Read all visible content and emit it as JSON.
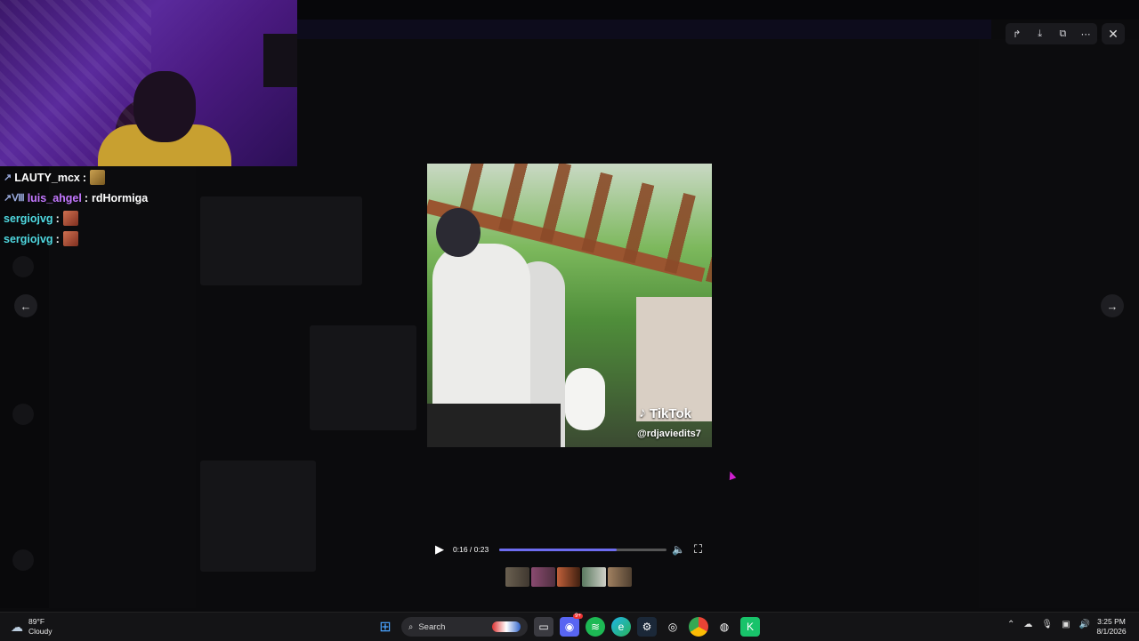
{
  "chat": [
    {
      "badge": "↗",
      "name": "LAUTY_mcx",
      "name_color": "#ffffff",
      "separator": ":",
      "message": "",
      "emote": "gold"
    },
    {
      "badge": "↗Ⅷ",
      "name": "luis_ahgel",
      "name_color": "#c377ff",
      "separator": ":",
      "message": "rdHormiga",
      "emote": ""
    },
    {
      "badge": "",
      "name": "sergiojvg",
      "name_color": "#4fd8e0",
      "separator": ":",
      "message": "",
      "emote": "red"
    },
    {
      "badge": "",
      "name": "sergiojvg",
      "name_color": "#4fd8e0",
      "separator": ":",
      "message": "",
      "emote": "red"
    }
  ],
  "viewer": {
    "actions": {
      "forward": "forward-icon",
      "download": "download-icon",
      "open_external": "open-external-icon",
      "more": "more-icon"
    },
    "close_icon": "close-icon",
    "nav_prev": "arrow-left-icon",
    "nav_next": "arrow-right-icon"
  },
  "video": {
    "watermark": "TikTok",
    "handle": "@rdjaviedits7",
    "current_time": "0:16",
    "duration": "0:23",
    "time_label": "0:16 / 0:23",
    "progress_fraction": 0.7
  },
  "taskbar": {
    "temperature": "89°F",
    "condition": "Cloudy",
    "search_label": "Search",
    "discord_badge": "9+",
    "time": "3:25 PM",
    "date": "8/1/2026"
  },
  "colors": {
    "progress": "#6d6cf0",
    "accent": "#5865f2"
  }
}
